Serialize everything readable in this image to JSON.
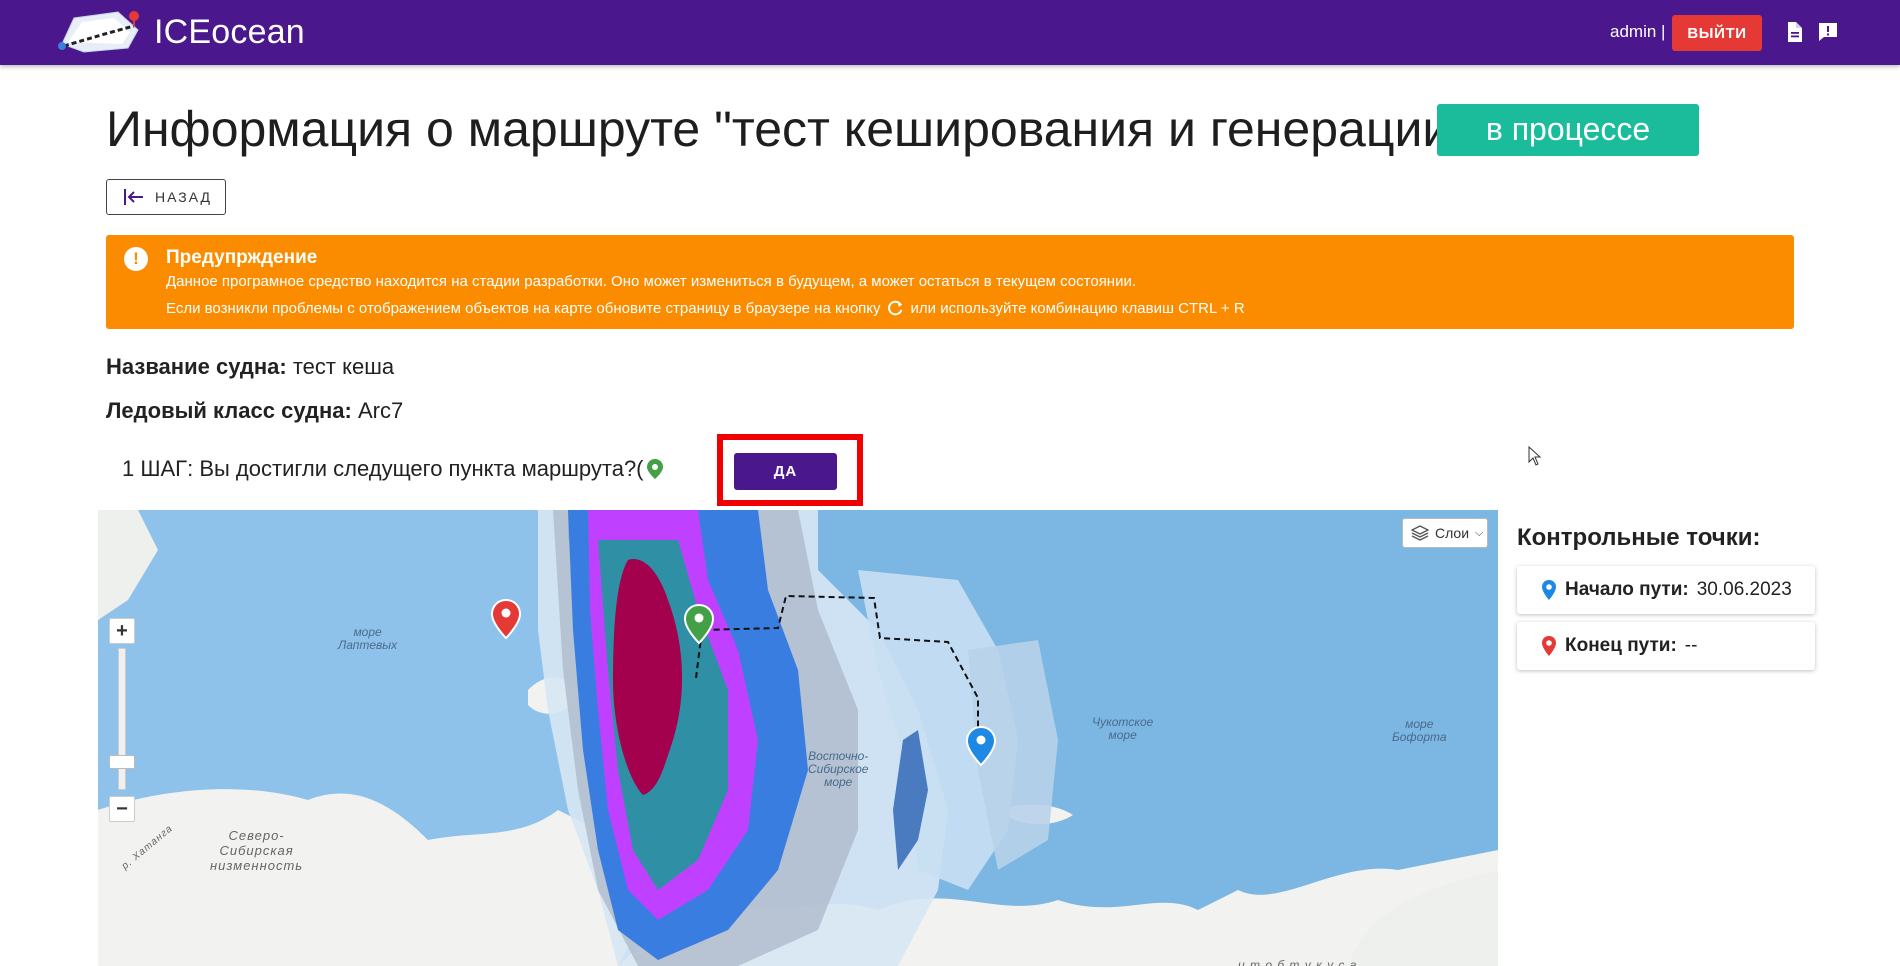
{
  "header": {
    "brand": "ICEocean",
    "user": "admin |",
    "logout_label": "выйти"
  },
  "page": {
    "title": "Информация о маршруте \"тест кеширования и генерации\"",
    "status": "в процессе",
    "back_label": "НАЗАД"
  },
  "warning": {
    "title": "Предупрждение",
    "line1": "Данное програмное средство находится на стадии разработки. Оно может измениться в будущем, а может остаться в текущем состоянии.",
    "line2_a": "Если возникли проблемы с отображением объектов на карте обновите страницу в браузере на кнопку",
    "line2_b": "или используйте комбинацию клавиш CTRL + R"
  },
  "vessel": {
    "name_label": "Название судна:",
    "name_value": "тест кеша",
    "ice_class_label": "Ледовый класс судна:",
    "ice_class_value": "Arc7"
  },
  "step": {
    "text": "1 ШАГ: Вы достигли следущего пункта маршрута?(",
    "yes_label": "ДА"
  },
  "map": {
    "layers_label": "Слои",
    "zoom_in": "+",
    "zoom_out": "−",
    "labels": {
      "laptev": "море\nЛаптевых",
      "east_siberian": "Восточно-\nСибирское\nморе",
      "chukchi": "Чукотское\nморе",
      "beaufort": "море\nБофорта",
      "siberian_lowland": "Северо-\nСибирская\nнизменность",
      "khatanga": "р. Хатанга",
      "bottom_partial": "и т о б т у к у с а"
    },
    "colors": {
      "sea": "#7cb6e3",
      "land": "#f2f2f0",
      "ice_dark": "#a3004d",
      "ice_teal": "#2e8fa5",
      "ice_magenta": "#c040ff",
      "ice_blue": "#3a7de0",
      "ice_light": "#c9e0f3"
    }
  },
  "checkpoints": {
    "title": "Контрольные точки:",
    "start_label": "Начало пути:",
    "start_value": "30.06.2023",
    "end_label": "Конец пути:",
    "end_value": "--"
  }
}
